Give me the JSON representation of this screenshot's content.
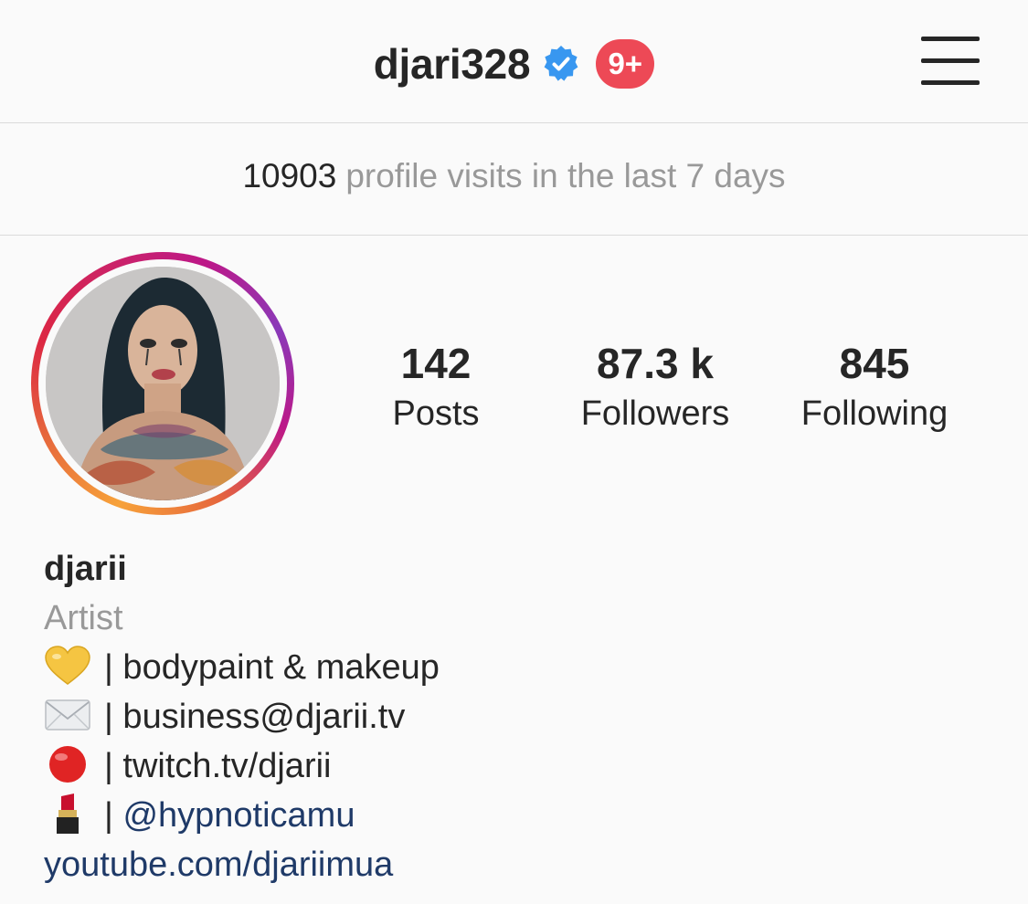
{
  "header": {
    "username": "djari328",
    "notification_badge": "9+"
  },
  "insights": {
    "visit_count": "10903",
    "visit_label": "profile visits in the last 7 days"
  },
  "stats": [
    {
      "value": "142",
      "label": "Posts"
    },
    {
      "value": "87.3 k",
      "label": "Followers"
    },
    {
      "value": "845",
      "label": "Following"
    }
  ],
  "bio": {
    "name": "djarii",
    "category": "Artist",
    "lines": [
      {
        "icon": "yellow-heart-icon",
        "text": "| bodypaint & makeup"
      },
      {
        "icon": "envelope-icon",
        "text": "| business@djarii.tv"
      },
      {
        "icon": "red-circle-icon",
        "text": "| twitch.tv/djarii"
      },
      {
        "icon": "lipstick-icon",
        "prefix": "|",
        "mention": "@hypnoticamu"
      }
    ],
    "website": "youtube.com/djariimua"
  },
  "colors": {
    "accent_badge": "#ed4956",
    "verified_blue": "#3897f0",
    "link_blue": "#1f3a68",
    "secondary_text": "#999999"
  }
}
